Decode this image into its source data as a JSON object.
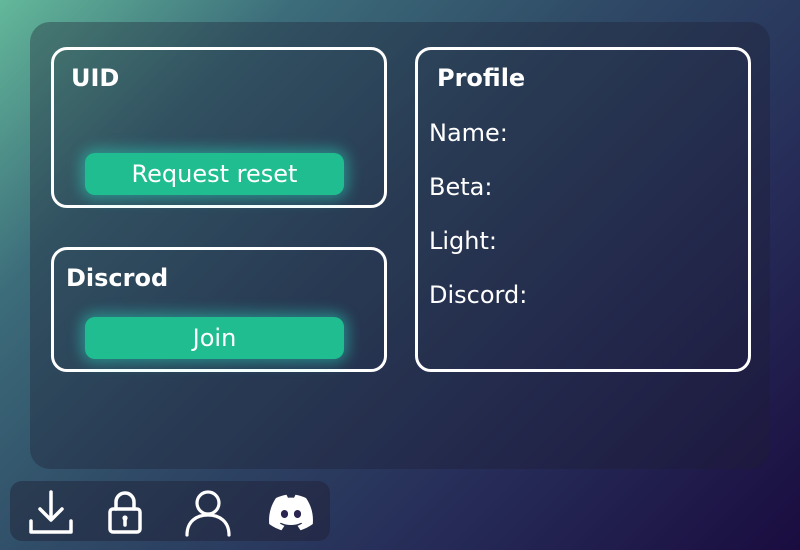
{
  "uid_card": {
    "title": "UID",
    "button_label": "Request reset"
  },
  "discord_card": {
    "title": "Discrod",
    "button_label": "Join"
  },
  "profile_card": {
    "title": "Profile",
    "fields": [
      {
        "label": "Name:"
      },
      {
        "label": "Beta:"
      },
      {
        "label": "Light:"
      },
      {
        "label": "Discord:"
      }
    ]
  },
  "toolbar": {
    "icons": [
      "download-icon",
      "lock-icon",
      "user-icon",
      "discord-icon"
    ]
  },
  "colors": {
    "accent_button": "#1fbd8f",
    "card_border": "#ffffff",
    "text": "#ffffff"
  }
}
